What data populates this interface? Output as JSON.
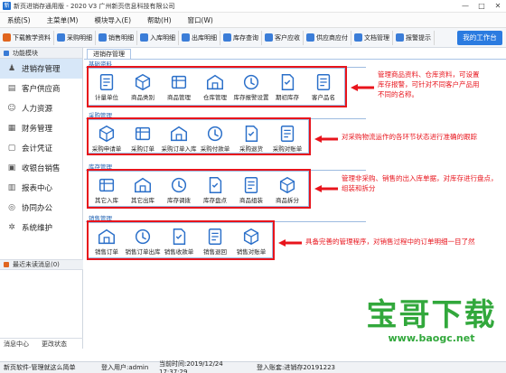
{
  "window": {
    "title": "新页进销存通用版 - 2020 V3 广州新页信息科技有限公司",
    "controls": [
      "—",
      "□",
      "✕"
    ]
  },
  "menu": [
    "系统(S)",
    "主菜单(M)",
    "模块导入(E)",
    "帮助(H)",
    "窗口(W)"
  ],
  "toolbar": {
    "items": [
      {
        "label": "下载教学资料",
        "color": "#e0651f"
      },
      {
        "label": "采购明细",
        "color": "#3b7dd8"
      },
      {
        "label": "销售明细",
        "color": "#3b7dd8"
      },
      {
        "label": "入库明细",
        "color": "#3b7dd8"
      },
      {
        "label": "出库明细",
        "color": "#3b7dd8"
      },
      {
        "label": "库存查询",
        "color": "#3b7dd8"
      },
      {
        "label": "客户应收",
        "color": "#3b7dd8"
      },
      {
        "label": "供应商应付",
        "color": "#3b7dd8"
      },
      {
        "label": "文档管理",
        "color": "#3b7dd8"
      },
      {
        "label": "报警提示",
        "color": "#3b7dd8"
      }
    ],
    "workbench": "我的工作台"
  },
  "sidebar": {
    "header": "功能模块",
    "items": [
      {
        "label": "进销存管理",
        "icon": "user-icon",
        "glyph": "♟"
      },
      {
        "label": "客户供应商",
        "icon": "book-icon",
        "glyph": "▤"
      },
      {
        "label": "人力资源",
        "icon": "person-icon",
        "glyph": "☺"
      },
      {
        "label": "财务管理",
        "icon": "doc-icon",
        "glyph": "▦"
      },
      {
        "label": "会计凭证",
        "icon": "voucher-icon",
        "glyph": "▢"
      },
      {
        "label": "收银台销售",
        "icon": "cashier-icon",
        "glyph": "▣"
      },
      {
        "label": "报表中心",
        "icon": "report-icon",
        "glyph": "▥"
      },
      {
        "label": "协同办公",
        "icon": "collab-icon",
        "glyph": "◎"
      },
      {
        "label": "系统维护",
        "icon": "settings-icon",
        "glyph": "✲"
      }
    ],
    "recent": "最近未读消息",
    "recent_count": "(0)",
    "footer": [
      "消息中心",
      "更改状态"
    ]
  },
  "tab": "进销存管理",
  "sections": [
    {
      "title": "基础资料",
      "items": [
        "计量单位",
        "商品类别",
        "商品管理",
        "仓库管理",
        "库存报警设置",
        "期初库存",
        "客户品名"
      ],
      "note": [
        "管理商品资料、仓库资料，可设置",
        "库存报警，可针对不同客户产品用",
        "不同的名称。"
      ]
    },
    {
      "title": "采购管理",
      "items": [
        "采购申请单",
        "采购订单",
        "采购订单入库",
        "采购付款单",
        "采购退货",
        "采购对账单"
      ],
      "note": [
        "对采购物流运作的各环节状态进行准确的跟踪"
      ]
    },
    {
      "title": "库存管理",
      "items": [
        "其它入库",
        "其它出库",
        "库存调拨",
        "库存盘点",
        "商品组装",
        "商品拆分"
      ],
      "note": [
        "管理非采购、销售的出入库单据，对库存进行盘点，",
        "组装和拆分"
      ]
    },
    {
      "title": "销售管理",
      "items": [
        "销售订单",
        "销售订单出库",
        "销售收款单",
        "销售退回",
        "销售对账单"
      ],
      "note": [
        "具备完善的管理程序，对销售过程中的订单明细一目了然"
      ]
    }
  ],
  "watermark": {
    "big": "宝哥下载",
    "url": "www.baogc.net"
  },
  "status": {
    "company": "新页软件-管理就这么简单",
    "user": "登入用户:admin",
    "time": "当前时间:2019/12/24 17:37:29",
    "account": "登入账套:进销存20191223"
  }
}
